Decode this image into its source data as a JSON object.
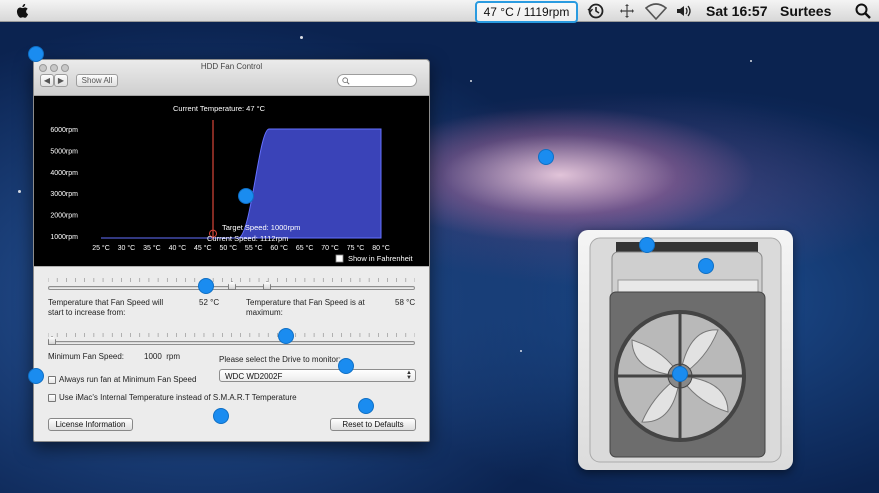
{
  "menubar": {
    "status_item": "47 °C / 1119rpm",
    "clock": "Sat 16:57",
    "user": "Surtees",
    "icons": [
      "apple-icon",
      "time-machine-icon",
      "network-icon",
      "wifi-icon",
      "volume-icon",
      "spotlight-icon"
    ]
  },
  "window": {
    "title": "HDD Fan Control",
    "show_all": "Show All",
    "back_arrow": "◀",
    "forward_arrow": "▶",
    "graph": {
      "current_temperature": "Current Temperature: 47 °C",
      "target_speed": "Target Speed: 1000rpm",
      "current_speed": "Current Speed: 1112rpm",
      "show_fahrenheit": "Show in Fahrenheit"
    },
    "temp_start_label": "Temperature that Fan Speed will start to increase from:",
    "temp_start_value": "52 °C",
    "temp_max_label": "Temperature that Fan Speed is at maximum:",
    "temp_max_value": "58 °C",
    "min_speed_label": "Minimum Fan Speed:",
    "min_speed_value": "1000  rpm",
    "drive_label": "Please select the Drive to monitor:",
    "drive_selected": "WDC WD2002F",
    "always_min_label": "Always run fan at Minimum Fan Speed",
    "imac_temp_label": "Use iMac's Internal Temperature instead of S.M.A.R.T Temperature",
    "license_button": "License Information",
    "reset_button": "Reset to Defaults"
  },
  "chart_data": {
    "type": "area",
    "title": "",
    "xlabel": "",
    "ylabel": "",
    "x_ticks": [
      "25 °C",
      "30 °C",
      "35 °C",
      "40 °C",
      "45 °C",
      "50 °C",
      "55 °C",
      "60 °C",
      "65 °C",
      "70 °C",
      "75 °C",
      "80 °C"
    ],
    "y_ticks": [
      "1000rpm",
      "2000rpm",
      "3000rpm",
      "4000rpm",
      "5000rpm",
      "6000rpm"
    ],
    "x_range": [
      25,
      80
    ],
    "y_range": [
      1000,
      6000
    ],
    "series": [
      {
        "points": [
          [
            25,
            1000
          ],
          [
            52,
            1000
          ],
          [
            58,
            6000
          ],
          [
            80,
            6000
          ]
        ],
        "color": "#3a43b8"
      }
    ],
    "current_temperature_c": 47,
    "current_speed_rpm": 1112
  },
  "colors": {
    "chart_fill": "#3a43b8",
    "marker_line": "#d9453a",
    "highlight_border": "#2a9be0",
    "annotation_dot": "#1a8cf0"
  }
}
